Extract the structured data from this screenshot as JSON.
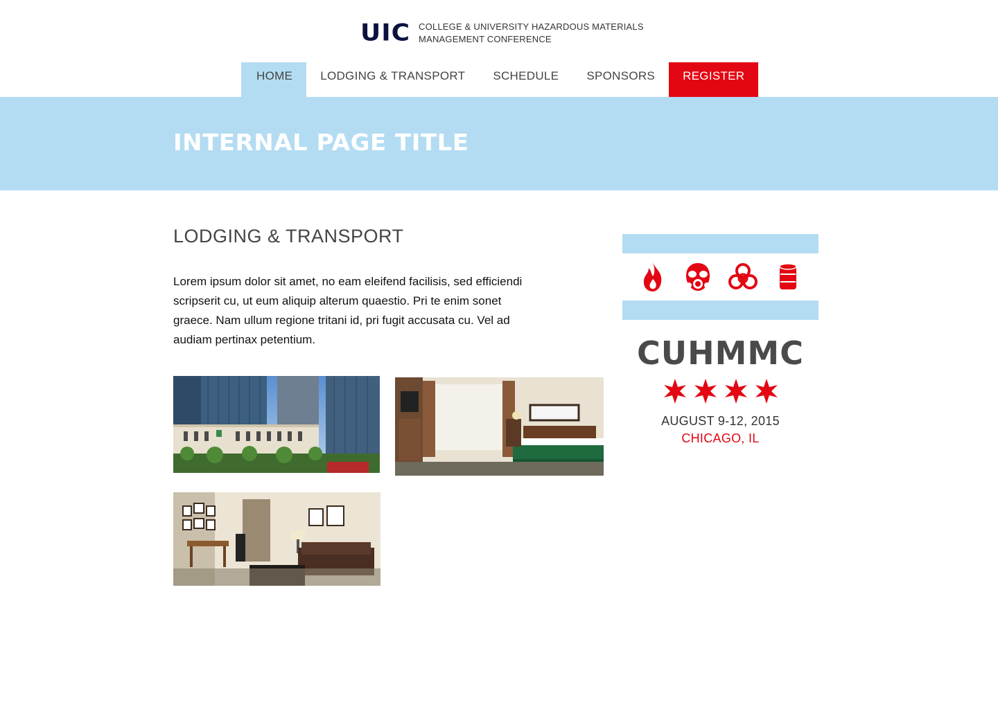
{
  "header": {
    "logo": "UIC",
    "subtitle_line1": "College & University Hazardous Materials",
    "subtitle_line2": "Management Conference"
  },
  "nav": {
    "items": [
      {
        "label": "Home",
        "active": true
      },
      {
        "label": "Lodging & Transport"
      },
      {
        "label": "Schedule"
      },
      {
        "label": "Sponsors"
      },
      {
        "label": "Register",
        "style": "red"
      }
    ]
  },
  "hero": {
    "title": "Internal Page Title"
  },
  "main": {
    "section_title": "Lodging & Transport",
    "body": "Lorem ipsum dolor sit amet, no eam eleifend facilisis, sed efficiendi scripserit cu, ut eum aliquip alterum quaestio. Pri te enim sonet graece. Nam ullum regione tritani id, pri fugit accusata cu. Vel ad audiam pertinax petentium.",
    "photos": [
      "hotel-exterior",
      "hotel-bedroom",
      "hotel-suite-living-room"
    ]
  },
  "sidebar": {
    "icons": [
      "flame-icon",
      "gas-mask-icon",
      "biohazard-icon",
      "barrel-icon"
    ],
    "title": "CUHMMC",
    "stars": 4,
    "date": "August 9-12, 2015",
    "city": "Chicago, IL"
  },
  "colors": {
    "accent_red": "#e30613",
    "light_blue": "#b3dcf2",
    "navy": "#0b1240"
  }
}
